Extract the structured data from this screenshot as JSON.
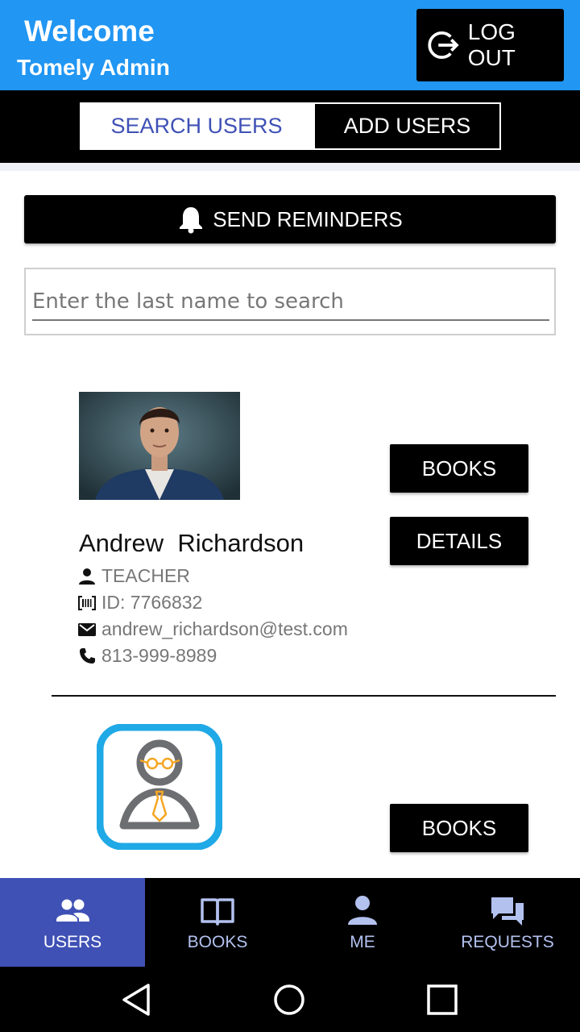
{
  "header": {
    "welcome": "Welcome",
    "admin_name": "Tomely Admin",
    "logout_label": "LOG OUT"
  },
  "tabs": {
    "search_users": "SEARCH USERS",
    "add_users": "ADD USERS"
  },
  "send_reminders_label": "SEND REMINDERS",
  "search": {
    "placeholder": "Enter the last name to search",
    "value": ""
  },
  "users": [
    {
      "name": "Andrew  Richardson",
      "role": "TEACHER",
      "id": "ID: 7766832",
      "email": "andrew_richardson@test.com",
      "phone": "813-999-8989",
      "books_label": "BOOKS",
      "details_label": "DETAILS"
    },
    {
      "books_label": "BOOKS"
    }
  ],
  "bottom_nav": [
    {
      "label": "USERS",
      "icon": "users-icon",
      "active": true
    },
    {
      "label": "BOOKS",
      "icon": "book-icon",
      "active": false
    },
    {
      "label": "ME",
      "icon": "person-icon",
      "active": false
    },
    {
      "label": "REQUESTS",
      "icon": "chat-icon",
      "active": false
    }
  ],
  "colors": {
    "header_blue": "#2196f3",
    "accent_indigo": "#3f51b5",
    "nav_inactive": "#b3c1ef",
    "avatar_blue": "#1fa9e6"
  }
}
